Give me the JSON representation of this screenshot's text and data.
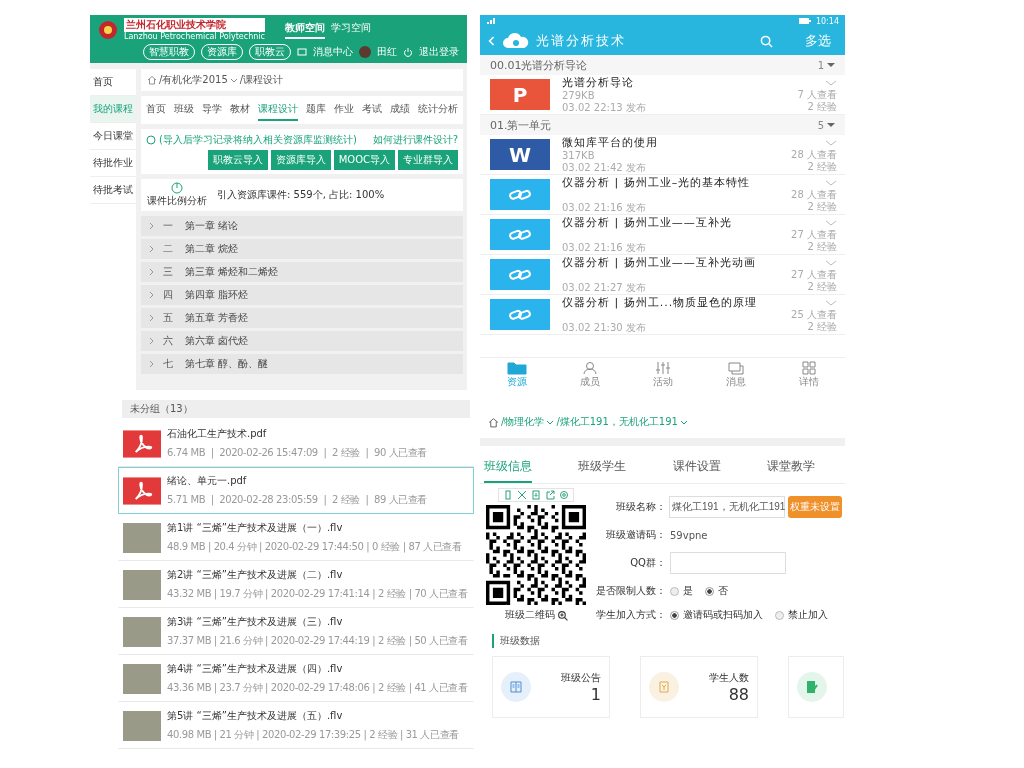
{
  "header": {
    "school_name": "兰州石化职业技术学院",
    "school_name_en": "Lanzhou Petrochemical Polytechnic",
    "nav": [
      {
        "label": "教师空间",
        "selected": true
      },
      {
        "label": "学习空间",
        "selected": false
      }
    ],
    "pill_buttons": [
      "智慧职教",
      "资源库",
      "职教云"
    ],
    "message_center": "消息中心",
    "user_name": "田红",
    "logout": "退出登录"
  },
  "sidebar": {
    "items": [
      {
        "label": "首页",
        "selected": false
      },
      {
        "label": "我的课程",
        "selected": true
      },
      {
        "label": "今日课堂",
        "selected": false
      },
      {
        "label": "待批作业",
        "selected": false
      },
      {
        "label": "待批考试",
        "selected": false
      }
    ]
  },
  "course": {
    "breadcrumb": [
      {
        "label": "/有机化学2015",
        "dropdown": true
      },
      {
        "label": "/课程设计",
        "dropdown": false
      }
    ],
    "tabs": [
      {
        "label": "首页",
        "selected": false
      },
      {
        "label": "班级",
        "selected": false
      },
      {
        "label": "导学",
        "selected": false
      },
      {
        "label": "教材",
        "selected": false
      },
      {
        "label": "课程设计",
        "selected": true
      },
      {
        "label": "题库",
        "selected": false
      },
      {
        "label": "作业",
        "selected": false
      },
      {
        "label": "考试",
        "selected": false
      },
      {
        "label": "成绩",
        "selected": false
      },
      {
        "label": "统计分析",
        "selected": false
      }
    ],
    "notice": "(导入后学习记录将纳入相关资源库监测统计)",
    "help_link": "如何进行课件设计?",
    "import_buttons": [
      "职教云导入",
      "资源库导入",
      "MOOC导入",
      "专业群导入"
    ],
    "stats": {
      "title": "课件比例分析",
      "text": "引入资源库课件: 559个, 占比: 100%"
    },
    "chapters": [
      {
        "number": "一",
        "title": "第一章 绪论"
      },
      {
        "number": "二",
        "title": "第二章 烷烃"
      },
      {
        "number": "三",
        "title": "第三章 烯烃和二烯烃"
      },
      {
        "number": "四",
        "title": "第四章 脂环烃"
      },
      {
        "number": "五",
        "title": "第五章 芳香烃"
      },
      {
        "number": "六",
        "title": "第六章 卤代烃"
      },
      {
        "number": "七",
        "title": "第七章 醇、酚、醚"
      }
    ]
  },
  "phone": {
    "time": "10:14",
    "title": "光谱分析技术",
    "multi_select": "多选",
    "sections": [
      {
        "title": "00.01光谱分析导论",
        "count": "1",
        "items": [
          {
            "kind": "ppt",
            "badge": "P",
            "title": "光谱分析导论",
            "size": "279KB",
            "date": "03.02 22:13 发布",
            "views": "7 人查看",
            "exp": "2 经验"
          }
        ]
      },
      {
        "title": "01.第一单元",
        "count": "5",
        "items": [
          {
            "kind": "word",
            "badge": "W",
            "title": "微知库平台的使用",
            "size": "317KB",
            "date": "03.02 21:42 发布",
            "views": "28 人查看",
            "exp": "2 经验"
          },
          {
            "kind": "link",
            "title": "仪器分析 | 扬州工业–光的基本特性",
            "date": "03.02 21:16 发布",
            "views": "28 人查看",
            "exp": "2 经验"
          },
          {
            "kind": "link",
            "title": "仪器分析 | 扬州工业——互补光",
            "date": "03.02 21:16 发布",
            "views": "27 人查看",
            "exp": "2 经验"
          },
          {
            "kind": "link",
            "title": "仪器分析 | 扬州工业——互补光动画",
            "date": "03.02 21:27 发布",
            "views": "27 人查看",
            "exp": "2 经验"
          },
          {
            "kind": "link",
            "title": "仪器分析 | 扬州工...物质显色的原理",
            "date": "03.02 21:30 发布",
            "views": "25 人查看",
            "exp": "2 经验"
          }
        ]
      }
    ],
    "nav": [
      {
        "kind": "folder",
        "label": "资源",
        "selected": true
      },
      {
        "kind": "person",
        "label": "成员",
        "selected": false
      },
      {
        "kind": "sliders",
        "label": "活动",
        "selected": false
      },
      {
        "kind": "chat",
        "label": "消息",
        "selected": false
      },
      {
        "kind": "grid",
        "label": "详情",
        "selected": false
      }
    ]
  },
  "files": {
    "group": "未分组（13）",
    "items": [
      {
        "kind": "pdf",
        "name": "石油化工生产技术.pdf",
        "meta": "6.74 MB  |  2020-02-26 15:47:09  |  2 经验  |  90 人已查看",
        "selected": false
      },
      {
        "kind": "pdf",
        "name": "绪论、单元一.pdf",
        "meta": "5.71 MB  |  2020-02-28 23:05:59  |  2 经验  |  89 人已查看",
        "selected": true
      },
      {
        "kind": "video",
        "name": "第1讲 “三烯”生产技术及进展（一）.flv",
        "meta": "48.9 MB | 20.4 分钟 | 2020-02-29 17:44:50 | 0 经验 | 87 人已查看",
        "selected": false
      },
      {
        "kind": "video",
        "name": "第2讲 “三烯”生产技术及进展（二）.flv",
        "meta": "43.32 MB | 19.7 分钟 | 2020-02-29 17:41:14 | 2 经验 | 70 人已查看",
        "selected": false
      },
      {
        "kind": "video",
        "name": "第3讲 “三烯”生产技术及进展（三）.flv",
        "meta": "37.37 MB | 21.6 分钟 | 2020-02-29 17:44:19 | 2 经验 | 50 人已查看",
        "selected": false
      },
      {
        "kind": "video",
        "name": "第4讲 “三烯”生产技术及进展（四）.flv",
        "meta": "43.36 MB | 23.7 分钟 | 2020-02-29 17:48:06 | 2 经验 | 41 人已查看",
        "selected": false
      },
      {
        "kind": "video",
        "name": "第5讲 “三烯”生产技术及进展（五）.flv",
        "meta": "40.98 MB | 21 分钟 | 2020-02-29 17:39:25 | 2 经验 | 31 人已查看",
        "selected": false
      }
    ]
  },
  "class_page": {
    "breadcrumb": [
      {
        "label": "/物理化学",
        "dropdown": true
      },
      {
        "label": "/煤化工191，无机化工191",
        "dropdown": true
      }
    ],
    "tabs": [
      {
        "label": "班级信息",
        "selected": true
      },
      {
        "label": "班级学生",
        "selected": false
      },
      {
        "label": "课件设置",
        "selected": false
      },
      {
        "label": "课堂教学",
        "selected": false
      }
    ],
    "qr_label": "班级二维码",
    "name_label": "班级名称：",
    "name_value": "煤化工191，无机化工191",
    "weight_button": "权重未设置",
    "invite_label": "班级邀请码：",
    "invite_code": "59vpne",
    "qq_label": "QQ群：",
    "limit_label": "是否限制人数：",
    "limit_options": [
      {
        "label": "是",
        "selected": false
      },
      {
        "label": "否",
        "selected": true
      }
    ],
    "join_label": "学生加入方式：",
    "join_options": [
      {
        "label": "邀请码或扫码加入",
        "selected": true
      },
      {
        "label": "禁止加入",
        "selected": false
      }
    ],
    "section_title": "班级数据",
    "cards": [
      {
        "kind": "notice",
        "label": "班级公告",
        "value": "1"
      },
      {
        "kind": "students",
        "label": "学生人数",
        "value": "88"
      },
      {
        "kind": "edit"
      }
    ]
  }
}
